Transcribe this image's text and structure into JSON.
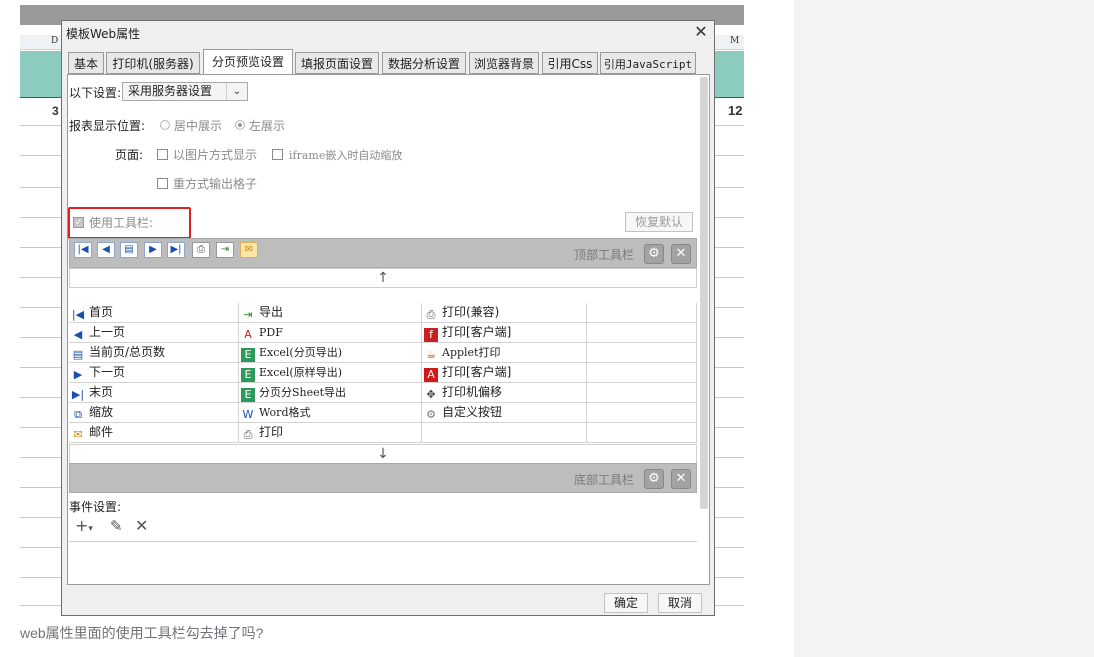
{
  "background": {
    "col_d": "D",
    "col_m": "M",
    "num_left": "3",
    "num_right": "12"
  },
  "dialog": {
    "title": "模板Web属性",
    "close_icon": "close-icon",
    "tabs": [
      "基本",
      "打印机(服务器)",
      "分页预览设置",
      "填报页面设置",
      "数据分析设置",
      "浏览器背景",
      "引用Css",
      "引用JavaScript"
    ],
    "active_tab": "分页预览设置",
    "settings_label": "以下设置:",
    "settings_value": "采用服务器设置",
    "position_label": "报表显示位置:",
    "radio_center": "居中展示",
    "radio_left": "左展示",
    "page_label": "页面:",
    "check_image": "以图片方式显示",
    "check_iframe": "iframe嵌入时自动缩放",
    "check_repeat": "重方式输出格子",
    "use_toolbar": "使用工具栏:",
    "use_toolbar_checked": true,
    "restore_default": "恢复默认",
    "top_toolbar_label": "顶部工具栏",
    "bottom_toolbar_label": "底部工具栏",
    "arrow_up": "↑",
    "arrow_down": "↓",
    "buttons_col1": [
      "首页",
      "上一页",
      "当前页/总页数",
      "下一页",
      "末页",
      "缩放",
      "邮件"
    ],
    "buttons_col2": [
      "导出",
      "PDF",
      "Excel(分页导出)",
      "Excel(原样导出)",
      "分页分Sheet导出",
      "Word格式",
      "打印"
    ],
    "buttons_col3": [
      "打印(兼容)",
      "打印[客户端]",
      "Applet打印",
      "打印[客户端]",
      "打印机偏移",
      "自定义按钮"
    ],
    "event_label": "事件设置:",
    "ok": "确定",
    "cancel": "取消"
  },
  "question": "web属性里面的使用工具栏勾去掉了吗?",
  "colors": {
    "teal_header": "#8ccbbf",
    "red_highlight": "#e02020",
    "toolbar_gray": "#bdbdbd",
    "side_panel": "#f2f3f5"
  }
}
